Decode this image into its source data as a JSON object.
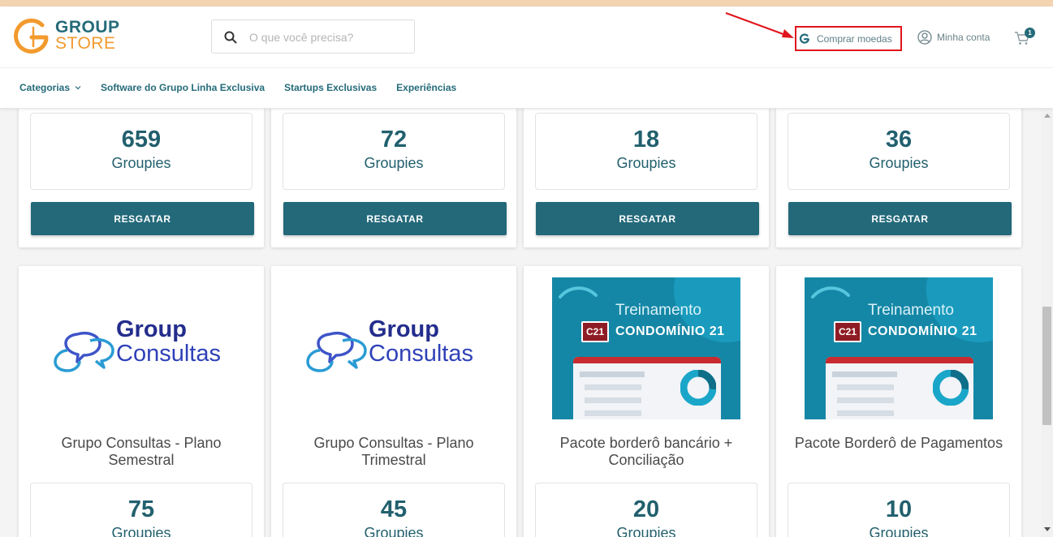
{
  "brand": {
    "line1": "GROUP",
    "line2": "STORE"
  },
  "search": {
    "placeholder": "O que você precisa?"
  },
  "header": {
    "buy_coins": "Comprar moedas",
    "account": "Minha conta",
    "cart_count": "1"
  },
  "nav": {
    "categories": "Categorias",
    "items": [
      "Software do Grupo Linha Exclusiva",
      "Startups Exclusivas",
      "Experiências"
    ]
  },
  "row1": [
    {
      "points": "659",
      "unit": "Groupies",
      "button": "RESGATAR"
    },
    {
      "points": "72",
      "unit": "Groupies",
      "button": "RESGATAR"
    },
    {
      "points": "18",
      "unit": "Groupies",
      "button": "RESGATAR"
    },
    {
      "points": "36",
      "unit": "Groupies",
      "button": "RESGATAR"
    }
  ],
  "row2": [
    {
      "title": "Grupo Consultas - Plano Semestral",
      "points": "75",
      "unit": "Groupies",
      "logo_line1": "Group",
      "logo_line2": "Consultas"
    },
    {
      "title": "Grupo Consultas - Plano Trimestral",
      "points": "45",
      "unit": "Groupies",
      "logo_line1": "Group",
      "logo_line2": "Consultas"
    },
    {
      "title": "Pacote borderô bancário + Conciliação",
      "points": "20",
      "unit": "Groupies",
      "banner_line1": "Treinamento",
      "banner_line2": "CONDOMÍNIO 21",
      "banner_badge": "C21"
    },
    {
      "title": "Pacote Borderô de Pagamentos",
      "points": "10",
      "unit": "Groupies",
      "banner_line1": "Treinamento",
      "banner_line2": "CONDOMÍNIO 21",
      "banner_badge": "C21"
    }
  ],
  "colors": {
    "teal": "#23697a",
    "orange": "#f29a2e",
    "annotation_red": "#e0141b"
  }
}
